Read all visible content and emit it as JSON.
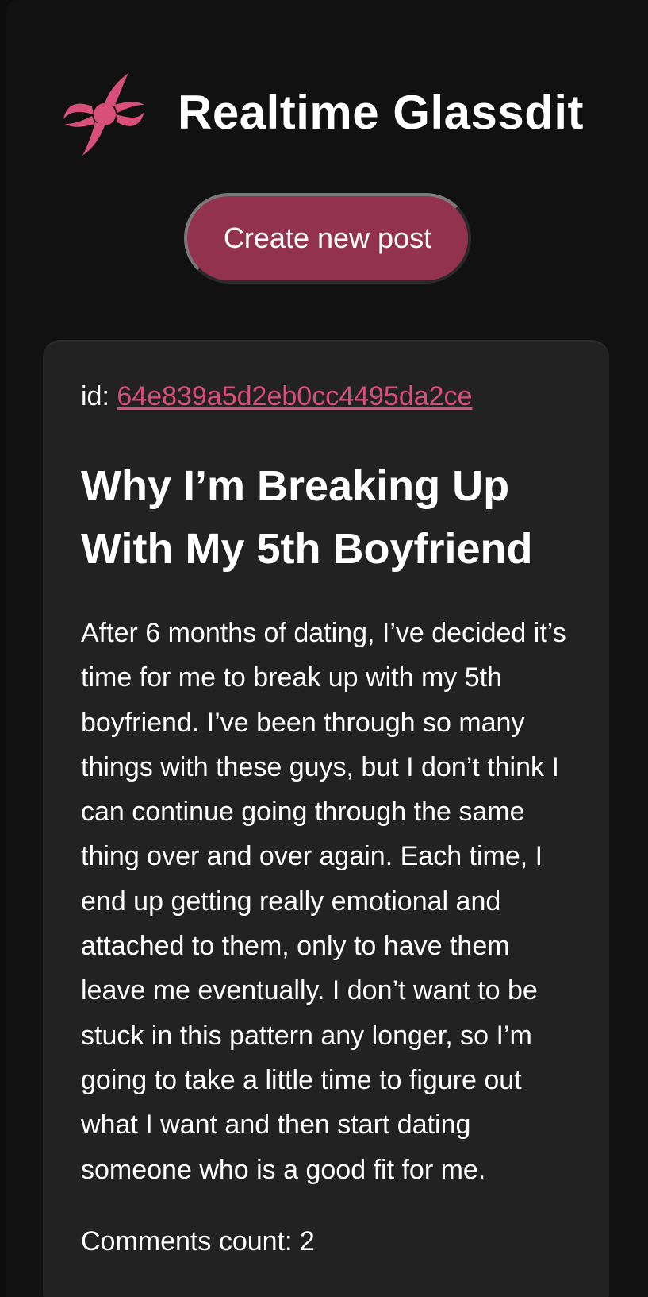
{
  "header": {
    "logo_icon": "swirl-logo-icon",
    "title": "Realtime Glassdit"
  },
  "actions": {
    "create_post_label": "Create new post"
  },
  "post": {
    "id_label": "id:",
    "id": "64e839a5d2eb0cc4495da2ce",
    "title": "Why I’m Breaking Up With My 5th Boyfriend",
    "body": "After 6 months of dating, I’ve decided it’s time for me to break up with my 5th boyfriend. I’ve been through so many things with these guys, but I don’t think I can continue going through the same thing over and over again. Each time, I end up getting really emotional and attached to them, only to have them leave me eventually. I don’t want to be stuck in this pattern any longer, so I’m going to take a little time to figure out what I want and then start dating someone who is a good fit for me.",
    "comments_label": "Comments count:",
    "comments_count": "2"
  },
  "colors": {
    "accent": "#d94f7c",
    "button": "#93324f",
    "background": "#111111",
    "card": "#222222"
  }
}
